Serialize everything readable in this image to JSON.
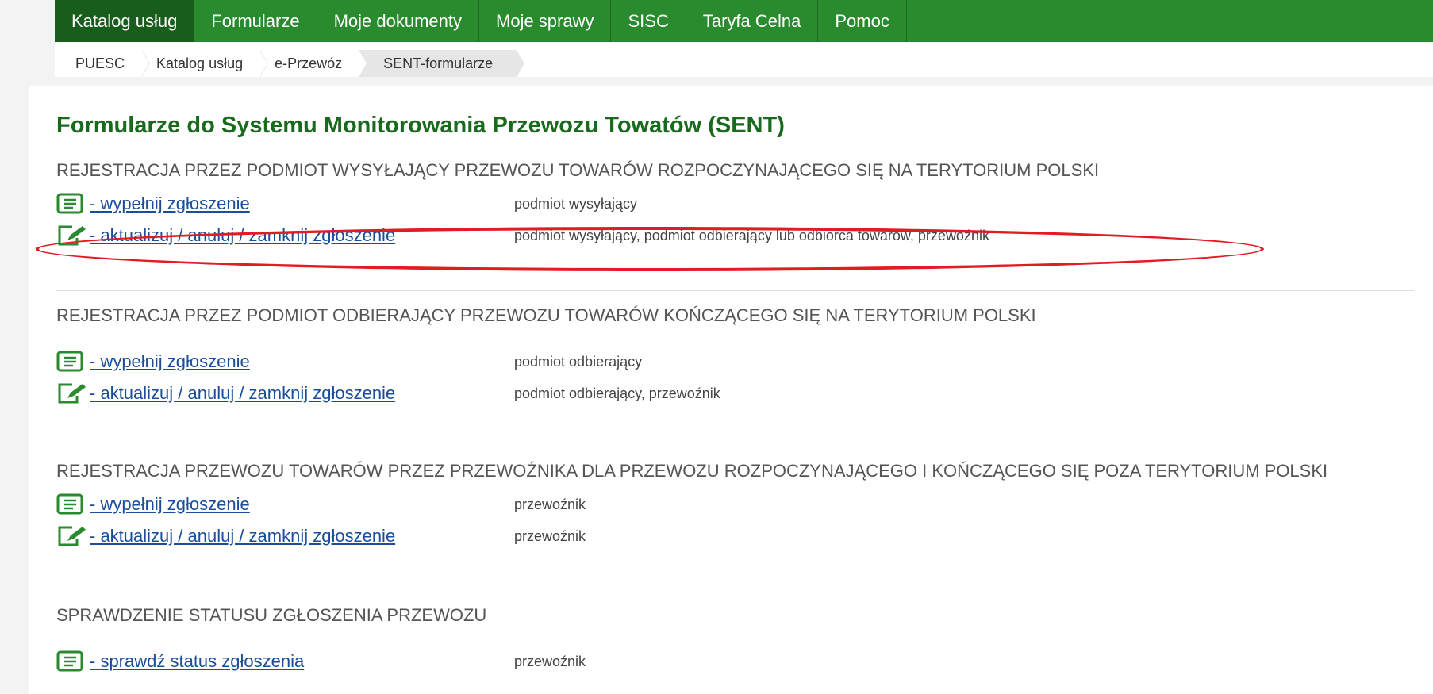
{
  "topnav": {
    "tabs": [
      {
        "label": "Katalog usług",
        "active": true
      },
      {
        "label": "Formularze",
        "active": false
      },
      {
        "label": "Moje dokumenty",
        "active": false
      },
      {
        "label": "Moje sprawy",
        "active": false
      },
      {
        "label": "SISC",
        "active": false
      },
      {
        "label": "Taryfa Celna",
        "active": false
      },
      {
        "label": "Pomoc",
        "active": false
      }
    ]
  },
  "breadcrumb": [
    "PUESC",
    "Katalog usług",
    "e-Przewóz",
    "SENT-formularze"
  ],
  "page": {
    "title": "Formularze do Systemu Monitorowania Przewozu Towatów (SENT)"
  },
  "sections": [
    {
      "heading": "REJESTRACJA PRZEZ PODMIOT WYSYŁAJĄCY PRZEWOZU TOWARÓW ROZPOCZYNAJĄCEGO SIĘ NA TERYTORIUM POLSKI",
      "rows": [
        {
          "icon": "form-icon",
          "link": "- wypełnij zgłoszenie",
          "role": "podmiot wysyłający"
        },
        {
          "icon": "edit-form-icon",
          "link": "- aktualizuj / anuluj / zamknij zgłoszenie",
          "role": "podmiot wysyłający, podmiot odbierający lub odbiorca towarów, przewoźnik"
        }
      ]
    },
    {
      "heading": "REJESTRACJA PRZEZ PODMIOT ODBIERAJĄCY PRZEWOZU TOWARÓW KOŃCZĄCEGO SIĘ NA TERYTORIUM POLSKI",
      "rows": [
        {
          "icon": "form-icon",
          "link": "- wypełnij zgłoszenie",
          "role": "podmiot odbierający"
        },
        {
          "icon": "edit-form-icon",
          "link": "- aktualizuj / anuluj / zamknij zgłoszenie",
          "role": "podmiot odbierający, przewoźnik"
        }
      ]
    },
    {
      "heading": "REJESTRACJA PRZEWOZU TOWARÓW PRZEZ PRZEWOŹNIKA DLA PRZEWOZU ROZPOCZYNAJĄCEGO I KOŃCZĄCEGO SIĘ POZA TERYTORIUM POLSKI",
      "rows": [
        {
          "icon": "form-icon",
          "link": "- wypełnij zgłoszenie",
          "role": "przewoźnik"
        },
        {
          "icon": "edit-form-icon",
          "link": "- aktualizuj / anuluj / zamknij zgłoszenie",
          "role": "przewoźnik"
        }
      ]
    },
    {
      "heading": "SPRAWDZENIE STATUSU ZGŁOSZENIA PRZEWOZU",
      "rows": [
        {
          "icon": "form-icon",
          "link": "- sprawdź status zgłoszenia",
          "role": "przewoźnik"
        }
      ]
    }
  ],
  "colors": {
    "nav_green": "#2a8a2e",
    "nav_active": "#195d1c",
    "title_green": "#1a6a1e",
    "link_blue": "#1a4d9a",
    "highlight_red": "#e31b23"
  }
}
